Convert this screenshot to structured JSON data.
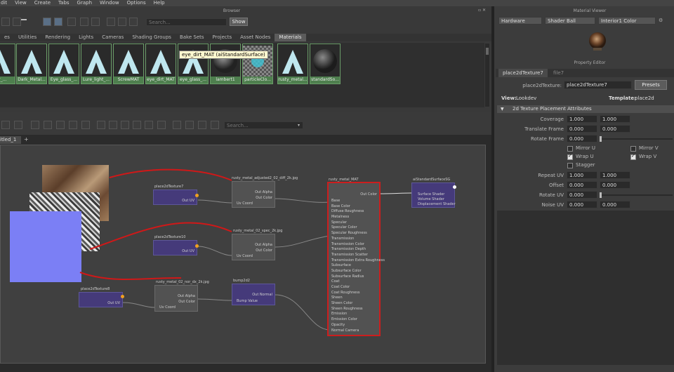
{
  "menu": [
    "dit",
    "View",
    "Create",
    "Tabs",
    "Graph",
    "Window",
    "Options",
    "Help"
  ],
  "browser": {
    "title": "Browser",
    "search_placeholder": "Search...",
    "show_label": "Show",
    "tabs": [
      "es",
      "Utilities",
      "Rendering",
      "Lights",
      "Cameras",
      "Shading Groups",
      "Bake Sets",
      "Projects",
      "Asset Nodes",
      "Materials"
    ],
    "swatches": [
      "her_...",
      "Dark_Metal...",
      "Eye_glass_...",
      "Lure_light_...",
      "ScrewMAT",
      "eye_dirt_MAT",
      "eye_glass_...",
      "lambert1",
      "particleClo...",
      "rusty_metal...",
      "standardSo..."
    ],
    "tooltip": "eye_dirt_MAT (aiStandardSurface)"
  },
  "editor": {
    "search_placeholder": "Search...",
    "tab_label": "itled_1",
    "add_tab": "+"
  },
  "nodes": {
    "place2dTexture7": {
      "title": "place2dTexture7",
      "out": "Out UV"
    },
    "place2dTexture10": {
      "title": "place2dTexture10",
      "out": "Out UV"
    },
    "place2dTexture8": {
      "title": "place2dTexture8",
      "out": "Out UV"
    },
    "diff": {
      "title": "rusty_metal_adjusted2_02_diff_2k.jpg",
      "ports": [
        "Out Alpha",
        "Out Color",
        "Uv Coord"
      ]
    },
    "spec": {
      "title": "rusty_metal_02_spec_2k.jpg",
      "ports": [
        "Out Alpha",
        "Out Color",
        "Uv Coord"
      ]
    },
    "nor": {
      "title": "rusty_metal_02_nor_dx_2k.jpg",
      "ports": [
        "Out Alpha",
        "Out Color",
        "Uv Coord"
      ]
    },
    "bump": {
      "title": "bump2d2",
      "ports": [
        "Out Normal",
        "Bump Value"
      ]
    },
    "mat": {
      "title": "rusty_metal_MAT",
      "out": "Out Color",
      "attrs": [
        "Base",
        "Base Color",
        "Diffuse Roughness",
        "Metalness",
        "Specular",
        "Specular Color",
        "Specular Roughness",
        "Transmission",
        "Transmission Color",
        "Transmission Depth",
        "Transmission Scatter",
        "Transmission Extra Roughness",
        "Subsurface",
        "Subsurface Color",
        "Subsurface Radius",
        "Coat",
        "Coat Color",
        "Coat Roughness",
        "Sheen",
        "Sheen Color",
        "Sheen Roughness",
        "Emission",
        "Emission Color",
        "Opacity",
        "Normal Camera"
      ]
    },
    "sg": {
      "title": "aiStandardSurfaceSG",
      "attrs": [
        "Surface Shader",
        "Volume Shader",
        "Displacement Shader"
      ]
    }
  },
  "material_viewer": {
    "title": "Material Viewer",
    "renderer": "Hardware",
    "shape": "Shader Ball",
    "env": "Interior1 Color"
  },
  "property_editor": {
    "title": "Property Editor",
    "tabs": [
      "place2dTexture7",
      "file7"
    ],
    "node_label": "place2dTexture:",
    "node_value": "place2dTexture7",
    "presets_label": "Presets",
    "view_label": "View:",
    "view_value": "Lookdev",
    "template_label": "Template:",
    "template_value": "place2d",
    "section": "2d Texture Placement Attributes",
    "rows": [
      {
        "label": "Coverage",
        "v1": "1.000",
        "v2": "1.000"
      },
      {
        "label": "Translate Frame",
        "v1": "0.000",
        "v2": "0.000"
      },
      {
        "label": "Rotate Frame",
        "v1": "0.000"
      },
      {
        "label": "Repeat UV",
        "v1": "1.000",
        "v2": "1.000"
      },
      {
        "label": "Offset",
        "v1": "0.000",
        "v2": "0.000"
      },
      {
        "label": "Rotate UV",
        "v1": "0.000"
      },
      {
        "label": "Noise UV",
        "v1": "0.000",
        "v2": "0.000"
      }
    ],
    "checks": {
      "mirror_u": "Mirror U",
      "mirror_v": "Mirror V",
      "wrap_u": "Wrap U",
      "wrap_v": "Wrap V",
      "stagger": "Stagger"
    }
  },
  "colors": {
    "purple_node": "#453a7a",
    "swatch_green": "#4e7f4e",
    "selection_red": "#cc1e1e",
    "normal_blue": "#7b7ff5",
    "link_red": "#d01818"
  }
}
